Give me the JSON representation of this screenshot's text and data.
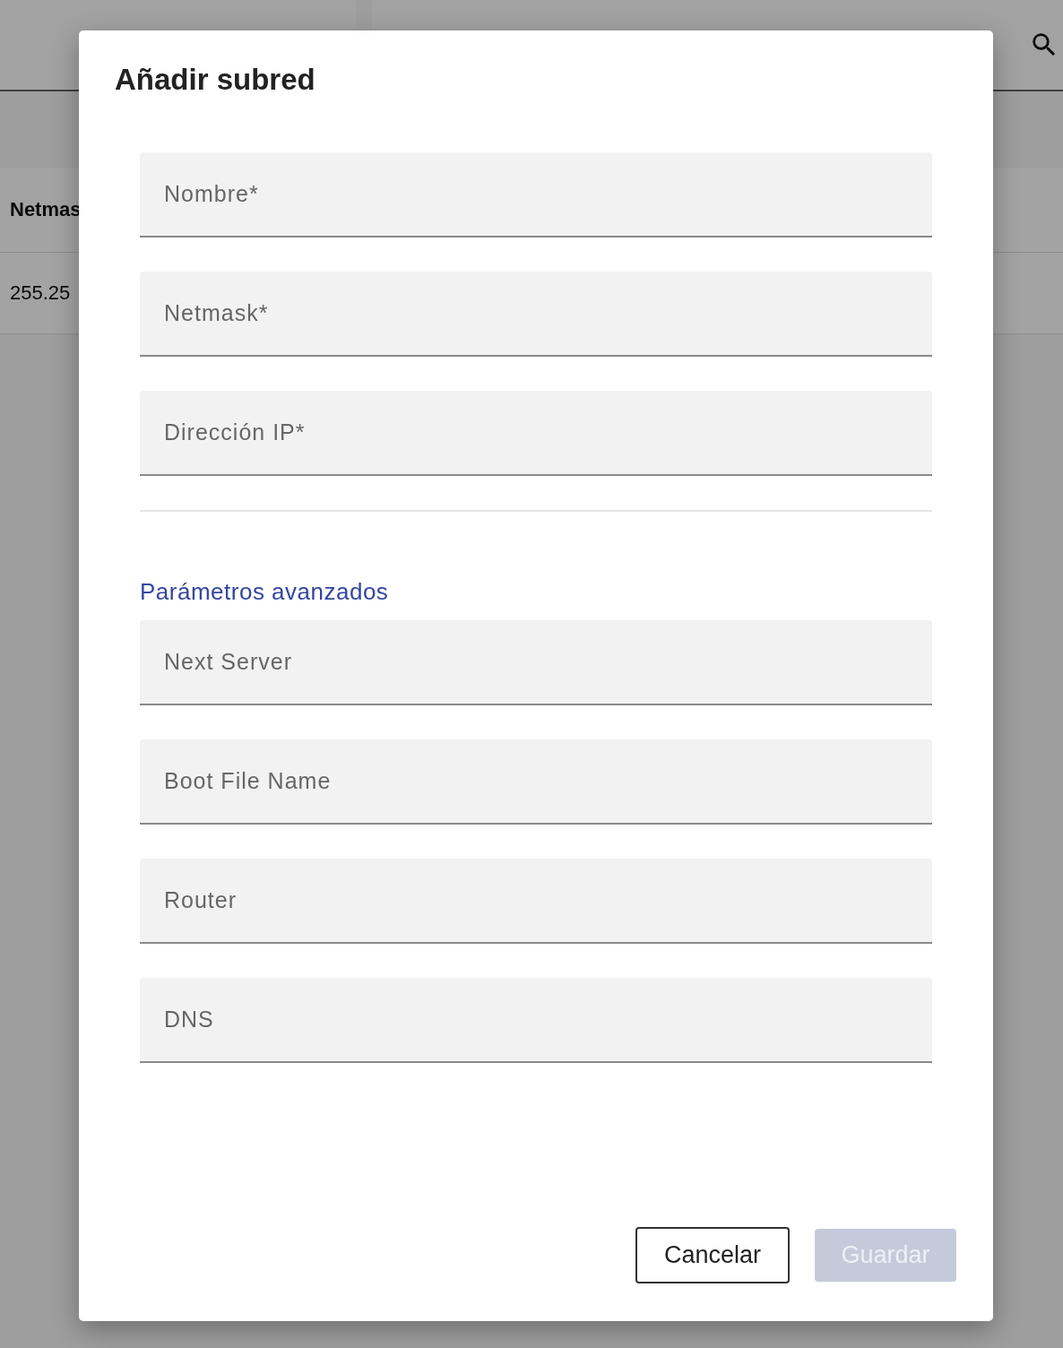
{
  "background": {
    "table": {
      "columns": [
        "Netmas"
      ],
      "rows": [
        [
          "255.25"
        ]
      ]
    }
  },
  "dialog": {
    "title": "Añadir subred",
    "fields": [
      {
        "placeholder": "Nombre*"
      },
      {
        "placeholder": "Netmask*"
      },
      {
        "placeholder": "Dirección IP*"
      }
    ],
    "section_title": "Parámetros avanzados",
    "advanced_fields": [
      {
        "placeholder": "Next Server"
      },
      {
        "placeholder": "Boot File Name"
      },
      {
        "placeholder": "Router"
      },
      {
        "placeholder": "DNS"
      }
    ],
    "buttons": [
      {
        "label": "Cancelar",
        "kind": "outlined",
        "disabled": false
      },
      {
        "label": "Guardar",
        "kind": "filled",
        "disabled": true
      }
    ]
  }
}
